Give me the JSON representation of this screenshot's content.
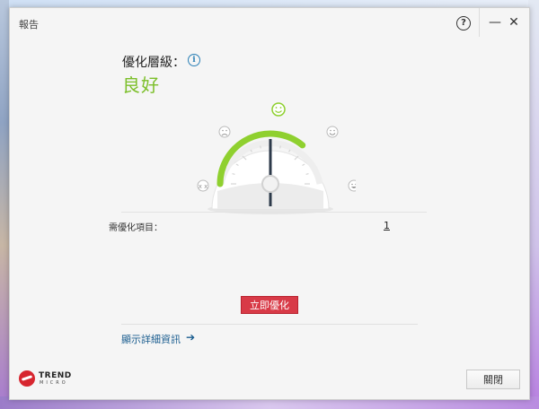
{
  "window": {
    "title": "報告"
  },
  "controls": {
    "help": "?",
    "minimize": "—",
    "close": "✕"
  },
  "status": {
    "level_label": "優化層級：",
    "info_glyph": "i",
    "level_value": "良好",
    "accent_color": "#7cbf2a"
  },
  "gauge": {
    "level_fraction": 0.72,
    "face_icons": [
      "dizzy-face-icon",
      "sad-face-icon",
      "happy-face-icon",
      "smile-face-icon",
      "grin-face-icon"
    ]
  },
  "items": {
    "label": "需優化項目：",
    "count": "1"
  },
  "actions": {
    "optimize_label": "立即優化",
    "details_label": "顯示詳細資訊",
    "details_arrow": "➔",
    "close_label": "關閉"
  },
  "logo": {
    "line1": "TREND",
    "line2": "MICRO"
  }
}
